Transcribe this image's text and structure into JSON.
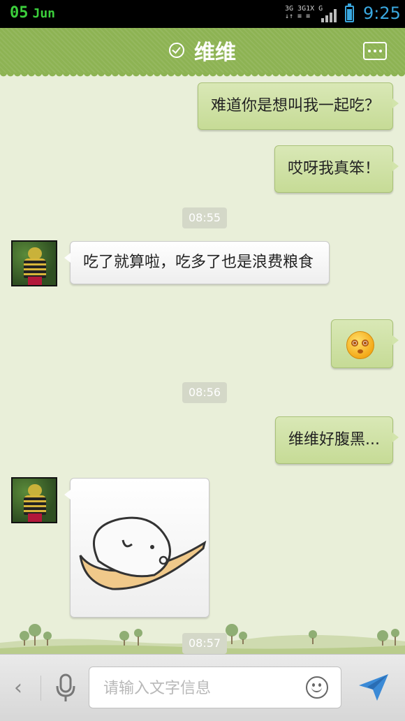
{
  "status_bar": {
    "day": "05",
    "month": "Jun",
    "network_top": "3G 3G1X G",
    "network_bottom": "↓↑ ≡ ≡",
    "time": "9:25",
    "battery_level": 0.78,
    "colors": {
      "date": "#3ccf3c",
      "time": "#3aa8e0"
    }
  },
  "header": {
    "title": "维维",
    "verified_icon": "check-circle-icon",
    "menu_icon": "more-dots-icon",
    "color": "#8db353"
  },
  "messages": [
    {
      "direction": "out",
      "text": "难道你是想叫我一起吃？"
    },
    {
      "direction": "out",
      "text": "哎呀我真笨！"
    },
    {
      "type": "timestamp",
      "text": "08:55"
    },
    {
      "direction": "in",
      "text": "吃了就算啦，吃多了也是浪费粮食"
    },
    {
      "direction": "out",
      "type": "emoji",
      "icon": "dizzy-face-icon"
    },
    {
      "type": "timestamp",
      "text": "08:56"
    },
    {
      "direction": "out",
      "text": "维维好腹黑..."
    },
    {
      "direction": "in",
      "type": "sticker",
      "icon": "rice-ball-on-spoon-sticker"
    },
    {
      "type": "timestamp",
      "text": "08:57"
    }
  ],
  "input_bar": {
    "back_icon": "chevron-left-icon",
    "voice_icon": "microphone-icon",
    "placeholder": "请输入文字信息",
    "emoji_icon": "smiley-icon",
    "send_icon": "paper-plane-icon"
  }
}
